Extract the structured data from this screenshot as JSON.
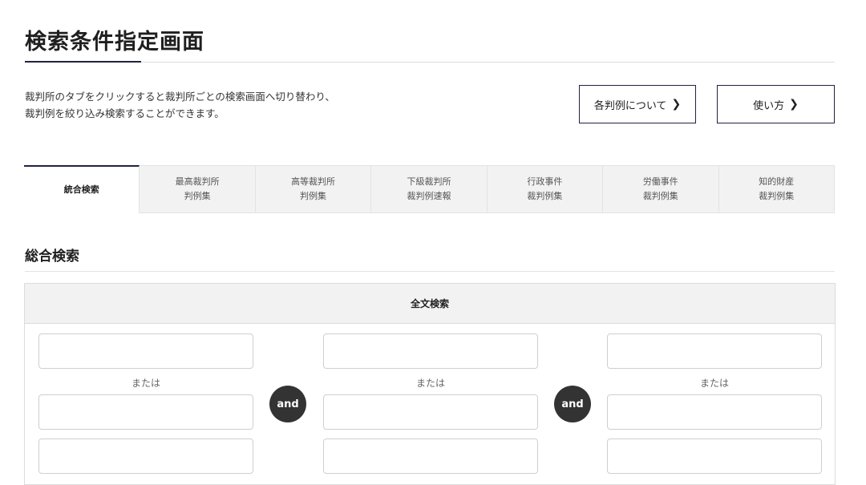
{
  "page_title": "検索条件指定画面",
  "intro": {
    "line1": "裁判所のタブをクリックすると裁判所ごとの検索画面へ切り替わり、",
    "line2": "裁判例を絞り込み検索することができます。"
  },
  "buttons": {
    "about": {
      "label": "各判例について",
      "chevron": "❯"
    },
    "howto": {
      "label": "使い方",
      "chevron": "❯"
    }
  },
  "tabs": [
    {
      "line1": "統合検索",
      "line2": "",
      "active": true
    },
    {
      "line1": "最高裁判所",
      "line2": "判例集",
      "active": false
    },
    {
      "line1": "高等裁判所",
      "line2": "判例集",
      "active": false
    },
    {
      "line1": "下級裁判所",
      "line2": "裁判例速報",
      "active": false
    },
    {
      "line1": "行政事件",
      "line2": "裁判例集",
      "active": false
    },
    {
      "line1": "労働事件",
      "line2": "裁判例集",
      "active": false
    },
    {
      "line1": "知的財産",
      "line2": "裁判例集",
      "active": false
    }
  ],
  "section_title": "総合検索",
  "fulltext": {
    "header": "全文検索",
    "or_label": "または",
    "and_label": "and",
    "fields": [
      {
        "value": "",
        "placeholder": ""
      },
      {
        "value": "",
        "placeholder": ""
      },
      {
        "value": "",
        "placeholder": ""
      },
      {
        "value": "",
        "placeholder": ""
      },
      {
        "value": "",
        "placeholder": ""
      },
      {
        "value": "",
        "placeholder": ""
      },
      {
        "value": "",
        "placeholder": ""
      },
      {
        "value": "",
        "placeholder": ""
      },
      {
        "value": "",
        "placeholder": ""
      }
    ]
  },
  "colors": {
    "accent": "#1f2340",
    "tab_bg": "#f2f2f2",
    "and_badge": "#333333"
  }
}
